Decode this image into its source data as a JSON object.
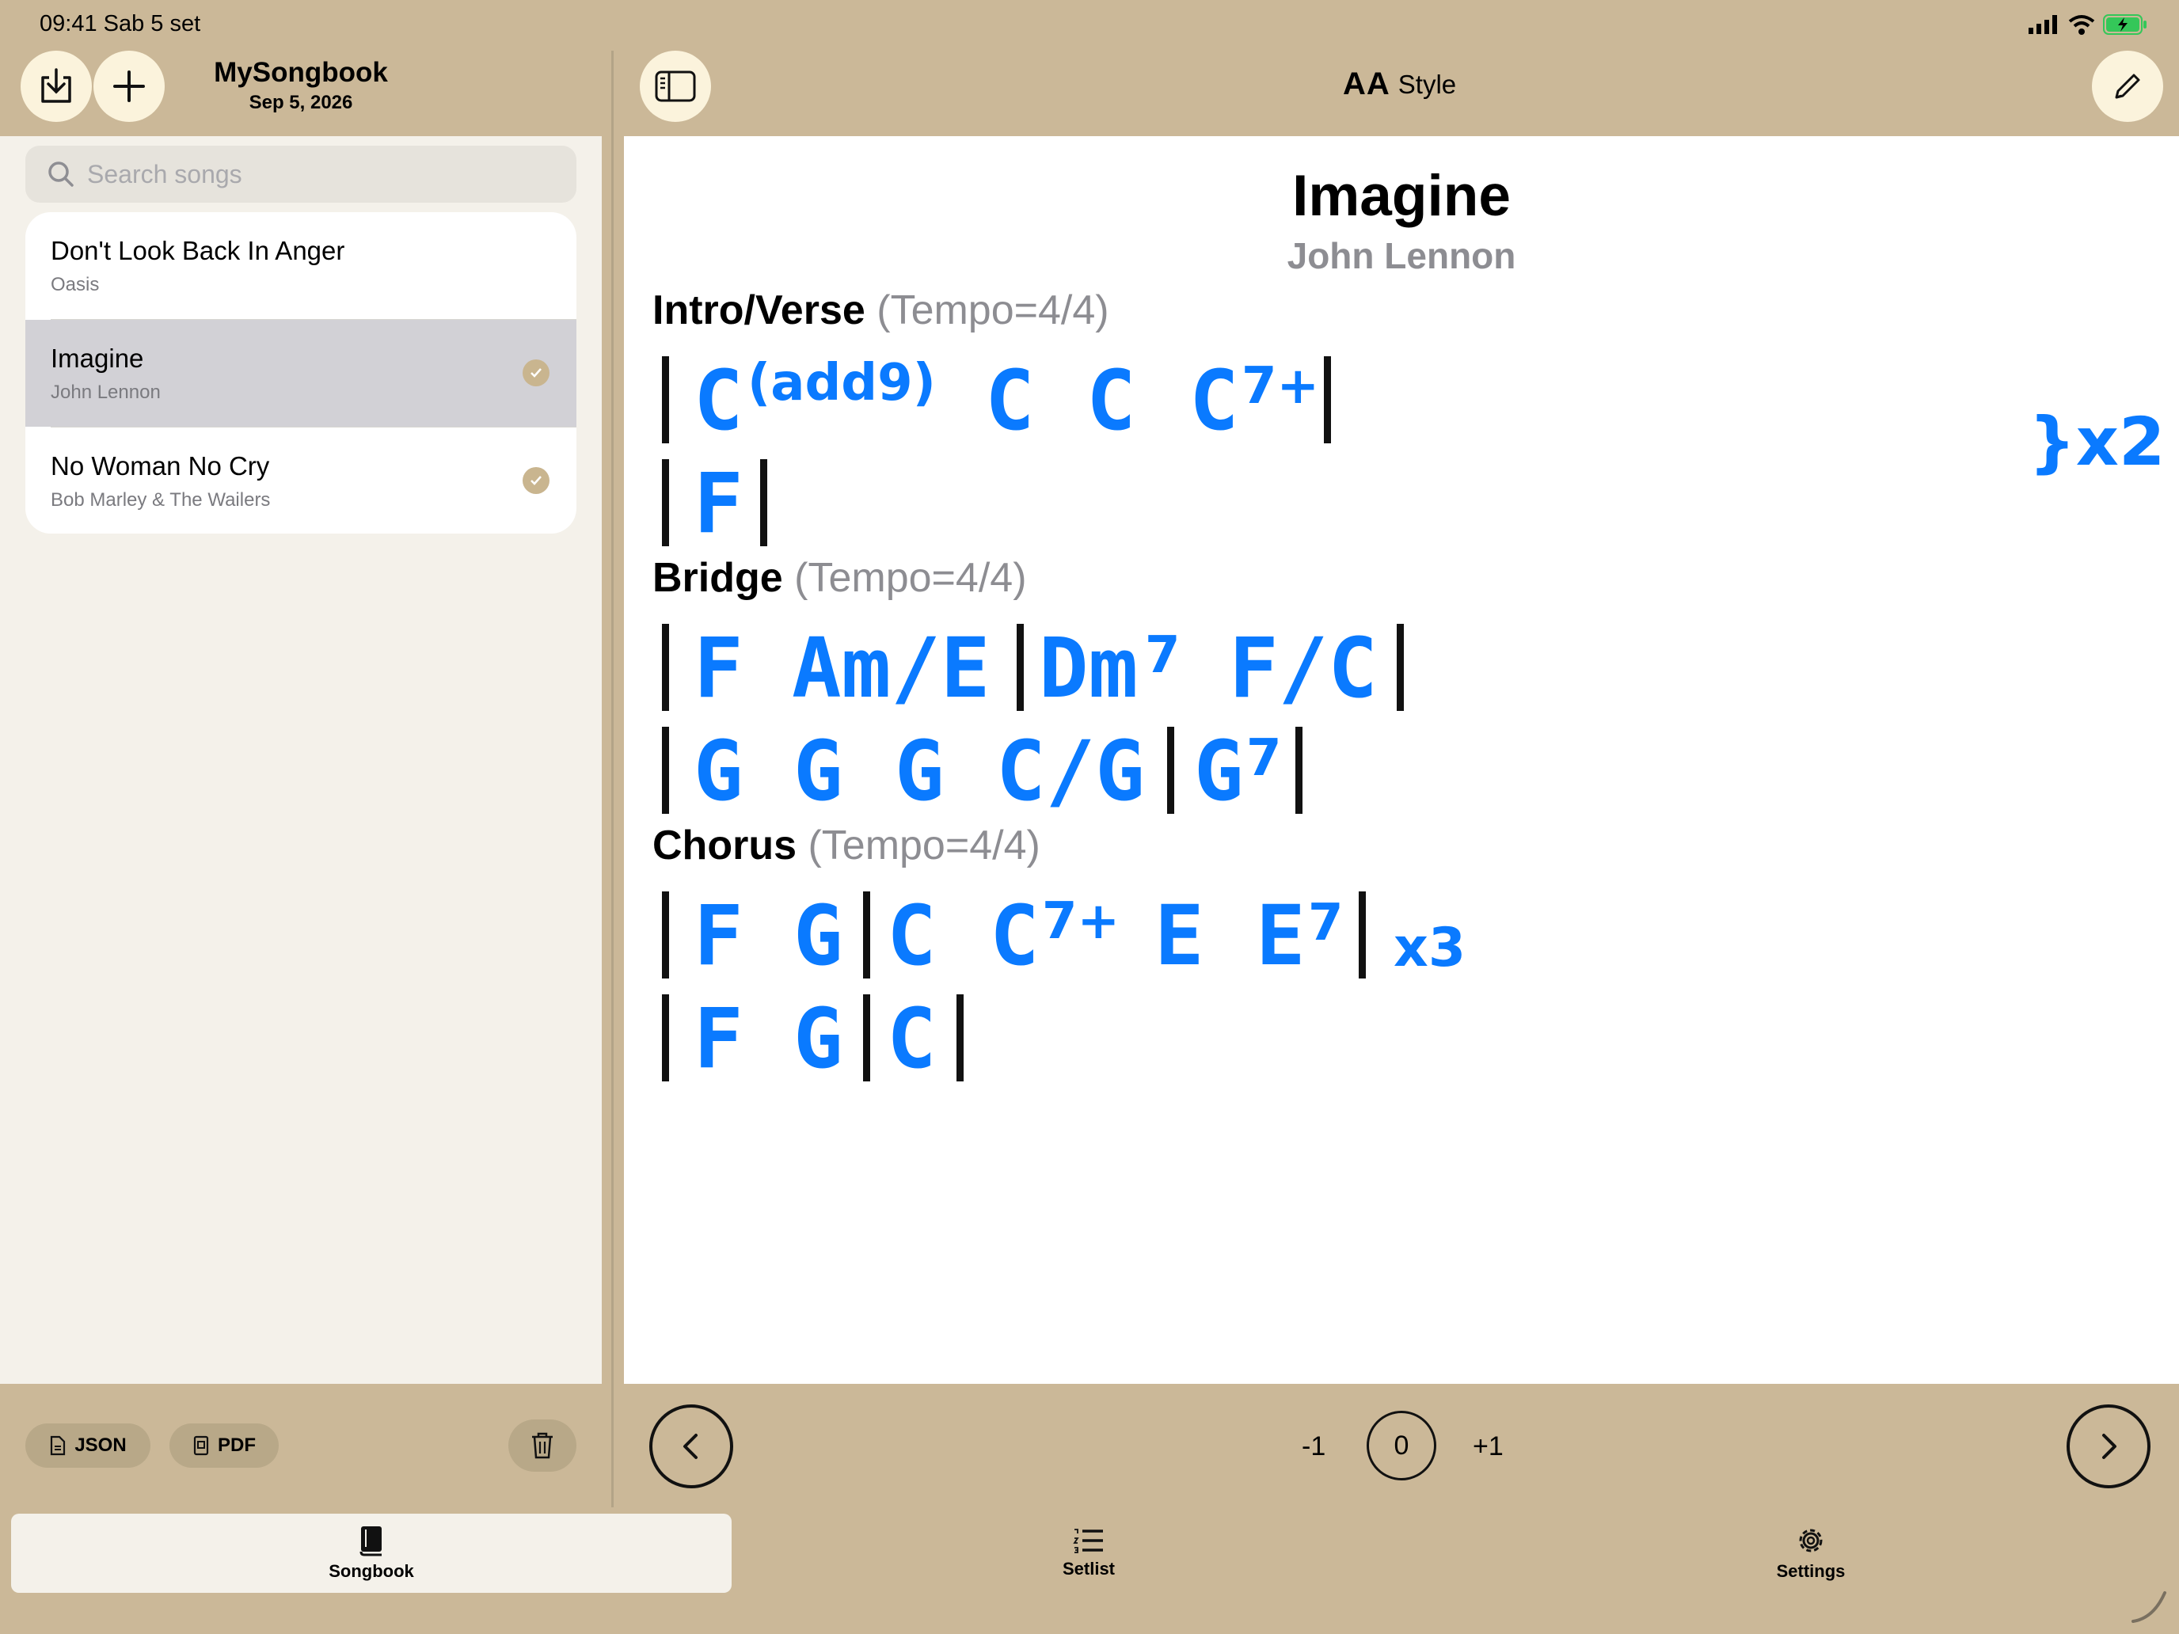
{
  "status": {
    "time_date": "09:41  Sab 5 set"
  },
  "sidebar": {
    "title": "MySongbook",
    "date": "Sep 5, 2026",
    "search_placeholder": "Search songs",
    "songs": [
      {
        "title": "Don't Look Back In Anger",
        "artist": "Oasis",
        "selected": false,
        "checked": false
      },
      {
        "title": "Imagine",
        "artist": "John Lennon",
        "selected": true,
        "checked": true
      },
      {
        "title": "No Woman No Cry",
        "artist": "Bob Marley & The Wailers",
        "selected": false,
        "checked": true
      }
    ],
    "export": {
      "json_label": "JSON",
      "pdf_label": "PDF"
    }
  },
  "toolbar": {
    "style_aa": "AA",
    "style_label": "Style"
  },
  "song": {
    "title": "Imagine",
    "artist": "John Lennon",
    "sections": [
      {
        "name": "Intro/Verse",
        "tempo": "(Tempo=4/4)",
        "repeat_brace": "}x2",
        "lines": [
          "|C(add9) C C C7+|",
          "|F|"
        ]
      },
      {
        "name": "Bridge",
        "tempo": "(Tempo=4/4)",
        "lines": [
          "|F Am/E|Dm7 F/C|",
          "|G G G C/G|G7|"
        ]
      },
      {
        "name": "Chorus",
        "tempo": "(Tempo=4/4)",
        "lines": [
          "|F G|C C7+ E E7| x3",
          "|F G|C|"
        ]
      }
    ],
    "chords": {
      "s1l1": [
        "C",
        "(add9)",
        "C",
        "C",
        "C",
        "7+"
      ],
      "s1l2": [
        "F"
      ],
      "s2l1": [
        "F",
        "Am/E",
        "Dm",
        "7",
        "F/C"
      ],
      "s2l2": [
        "G",
        "G",
        "G",
        "C/G",
        "G",
        "7"
      ],
      "s3l1": [
        "F",
        "G",
        "C",
        "C",
        "7+",
        "E",
        "E",
        "7"
      ],
      "s3l2": [
        "F",
        "G",
        "C"
      ],
      "chorus_repeat": "x3"
    }
  },
  "transpose": {
    "minus": "-1",
    "value": "0",
    "plus": "+1"
  },
  "tabs": [
    {
      "label": "Songbook",
      "icon": "book-icon",
      "active": true
    },
    {
      "label": "Setlist",
      "icon": "list-icon",
      "active": false
    },
    {
      "label": "Settings",
      "icon": "gear-icon",
      "active": false
    }
  ],
  "colors": {
    "background": "#cbb898",
    "chord": "#0a7aff",
    "button_fill": "#fbf3dc",
    "panel": "#f4f1ea"
  }
}
